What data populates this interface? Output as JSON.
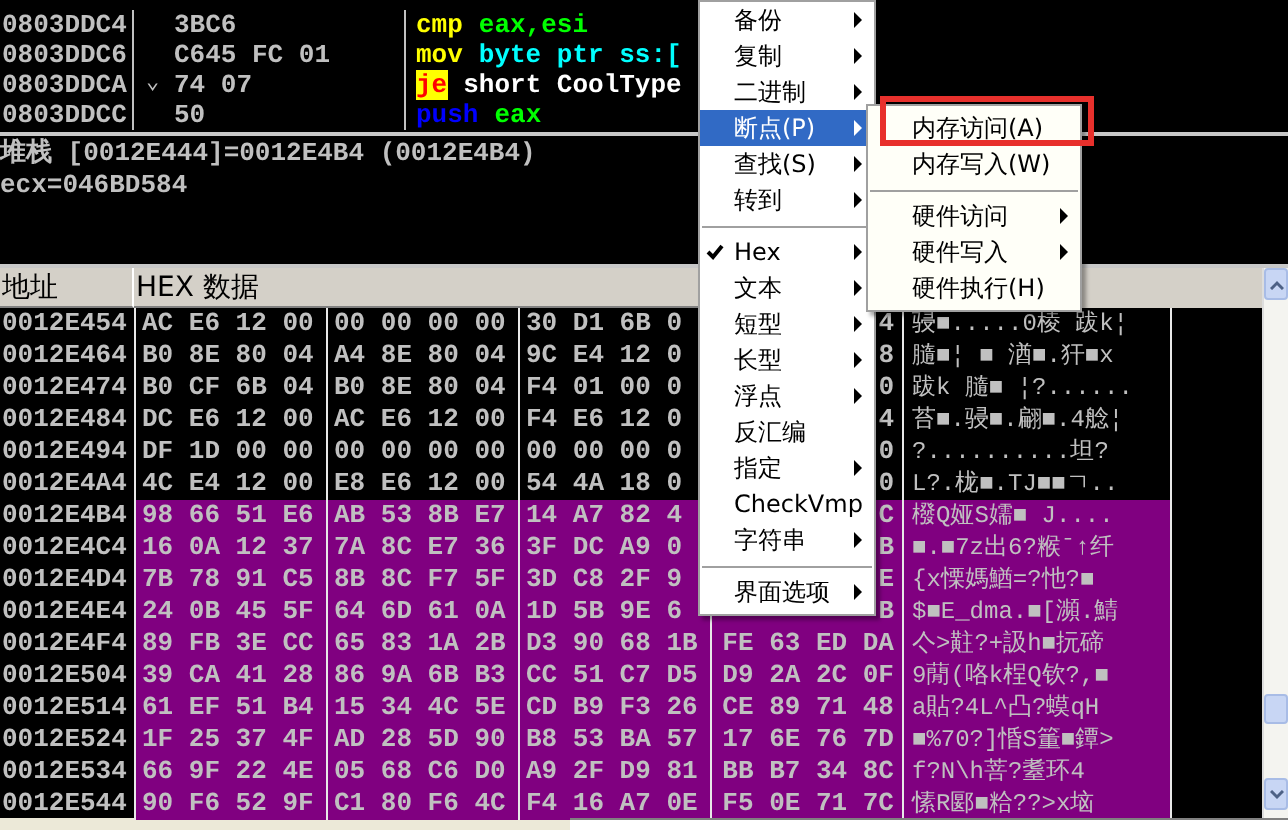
{
  "disassembly": {
    "rows": [
      {
        "address": "0803DDC4",
        "bytes": "3BC6",
        "parts": [
          {
            "text": "cmp",
            "kind": "mnemonic"
          },
          {
            "text": "eax,esi",
            "kind": "register"
          }
        ]
      },
      {
        "address": "0803DDC6",
        "bytes": "C645 FC 01",
        "parts": [
          {
            "text": "mov",
            "kind": "mnemonic"
          },
          {
            "text": "byte ptr ss:[",
            "kind": "memory"
          }
        ]
      },
      {
        "address": "0803DDCA",
        "jump_mark": "⌄",
        "bytes": "74 07",
        "parts": [
          {
            "text": "je",
            "kind": "jump"
          },
          {
            "text": "short CoolType",
            "kind": "label"
          }
        ]
      },
      {
        "address": "0803DDCC",
        "bytes": "50",
        "parts": [
          {
            "text": "push",
            "kind": "stack"
          },
          {
            "text": "eax",
            "kind": "register"
          }
        ]
      }
    ]
  },
  "info": {
    "lines": [
      "堆栈 [0012E444]=0012E4B4 (0012E4B4)",
      "ecx=046BD584"
    ]
  },
  "dump": {
    "columns": [
      "地址",
      "HEX 数据"
    ],
    "rows": [
      {
        "address": "0012E454",
        "hex": [
          "AC E6 12 00",
          "00 00 00 00",
          "30 D1 6B 0",
          "4"
        ],
        "text": "骎■.....0棱 跋k¦",
        "selected": false
      },
      {
        "address": "0012E464",
        "hex": [
          "B0 8E 80 04",
          "A4 8E 80 04",
          "9C E4 12 0",
          "8"
        ],
        "text": "膸■¦ ■ 湭■.犴■x",
        "selected": false
      },
      {
        "address": "0012E474",
        "hex": [
          "B0 CF 6B 04",
          "B0 8E 80 04",
          "F4 01 00 0",
          "0"
        ],
        "text": "跋k 膸■ ¦?......",
        "selected": false
      },
      {
        "address": "0012E484",
        "hex": [
          "DC E6 12 00",
          "AC E6 12 00",
          "F4 E6 12 0",
          "4"
        ],
        "text": "苔■.骎■.翩■.4艌¦",
        "selected": false
      },
      {
        "address": "0012E494",
        "hex": [
          "DF 1D 00 00",
          "00 00 00 00",
          "00 00 00 0",
          "0"
        ],
        "text": "?..........坦?",
        "selected": false
      },
      {
        "address": "0012E4A4",
        "hex": [
          "4C E4 12 00",
          "E8 E6 12 00",
          "54 4A 18 0",
          "0"
        ],
        "text": "L?.栊■.TJ■■ㄱ..",
        "selected": false
      },
      {
        "address": "0012E4B4",
        "hex": [
          "98 66 51 E6",
          "AB 53 8B E7",
          "14 A7 82 4",
          "C"
        ],
        "text": "橃Q娅S嬬■  J....",
        "selected": true
      },
      {
        "address": "0012E4C4",
        "hex": [
          "16 0A 12 37",
          "7A 8C E7 36",
          "3F DC A9 0",
          "B"
        ],
        "text": "■.■7z出6?糇ˉ↑纤",
        "selected": true
      },
      {
        "address": "0012E4D4",
        "hex": [
          "7B 78 91 C5",
          "8B 8C F7 5F",
          "3D C8 2F 9",
          "E"
        ],
        "text": "{x慄媽鰌=?忚?■",
        "selected": true
      },
      {
        "address": "0012E4E4",
        "hex": [
          "24 0B 45 5F",
          "64 6D 61 0A",
          "1D 5B 9E 6",
          "B"
        ],
        "text": "$■E_dma.■[瀕.鯖",
        "selected": true
      },
      {
        "address": "0012E4F4",
        "hex": [
          "89 FB 3E CC",
          "65 83 1A 2B",
          "D3 90 68 1B",
          "FE 63 ED DA"
        ],
        "text": "亽>黈?+訯h■抏碲",
        "selected": true
      },
      {
        "address": "0012E504",
        "hex": [
          "39 CA 41 28",
          "86 9A 6B B3",
          "CC 51 C7 D5",
          "D9 2A 2C 0F"
        ],
        "text": "9蕑(咯k桯Q钦?,■",
        "selected": true
      },
      {
        "address": "0012E514",
        "hex": [
          "61 EF 51 B4",
          "15 34 4C 5E",
          "CD B9 F3 26",
          "CE 89 71 48"
        ],
        "text": "a貼?4L^凸?蟆qH",
        "selected": true
      },
      {
        "address": "0012E524",
        "hex": [
          "1F 25 37 4F",
          "AD 28 5D 90",
          "B8 53 BA 57",
          "17 6E 76 7D"
        ],
        "text": "■%70?]惛S箽■鐔>",
        "selected": true
      },
      {
        "address": "0012E534",
        "hex": [
          "66 9F 22 4E",
          "05 68 C6 D0",
          "A9 2F D9 81",
          "BB B7 34 8C"
        ],
        "text": "f?N\\h菩?耋环4",
        "selected": true
      },
      {
        "address": "0012E544",
        "hex": [
          "90 F6 52 9F",
          "C1 80 F6 4C",
          "F4 16 A7 0E",
          "F5 0E 71 7C"
        ],
        "text": "愫R郾■粭??>x垴",
        "selected": true
      }
    ]
  },
  "context_menu": {
    "items": [
      {
        "kind": "item",
        "label": "备份",
        "has_submenu": true,
        "selected": false,
        "checked": false
      },
      {
        "kind": "item",
        "label": "复制",
        "has_submenu": true,
        "selected": false,
        "checked": false
      },
      {
        "kind": "item",
        "label": "二进制",
        "has_submenu": true,
        "selected": false,
        "checked": false
      },
      {
        "kind": "item",
        "label": "断点(P)",
        "has_submenu": true,
        "selected": true,
        "checked": false
      },
      {
        "kind": "item",
        "label": "查找(S)",
        "has_submenu": true,
        "selected": false,
        "checked": false
      },
      {
        "kind": "item",
        "label": "转到",
        "has_submenu": true,
        "selected": false,
        "checked": false
      },
      {
        "kind": "separator"
      },
      {
        "kind": "item",
        "label": "Hex",
        "has_submenu": true,
        "selected": false,
        "checked": true
      },
      {
        "kind": "item",
        "label": "文本",
        "has_submenu": true,
        "selected": false,
        "checked": false
      },
      {
        "kind": "item",
        "label": "短型",
        "has_submenu": true,
        "selected": false,
        "checked": false
      },
      {
        "kind": "item",
        "label": "长型",
        "has_submenu": true,
        "selected": false,
        "checked": false
      },
      {
        "kind": "item",
        "label": "浮点",
        "has_submenu": true,
        "selected": false,
        "checked": false
      },
      {
        "kind": "item",
        "label": "反汇编",
        "has_submenu": false,
        "selected": false,
        "checked": false
      },
      {
        "kind": "item",
        "label": "指定",
        "has_submenu": true,
        "selected": false,
        "checked": false
      },
      {
        "kind": "item",
        "label": "CheckVmp",
        "has_submenu": false,
        "selected": false,
        "checked": false
      },
      {
        "kind": "item",
        "label": "字符串",
        "has_submenu": true,
        "selected": false,
        "checked": false
      },
      {
        "kind": "separator"
      },
      {
        "kind": "item",
        "label": "界面选项",
        "has_submenu": true,
        "selected": false,
        "checked": false
      }
    ]
  },
  "submenu": {
    "items": [
      {
        "kind": "item",
        "label": "内存访问(A)",
        "has_submenu": false,
        "annotated": true
      },
      {
        "kind": "item",
        "label": "内存写入(W)",
        "has_submenu": false,
        "annotated": false
      },
      {
        "kind": "separator"
      },
      {
        "kind": "item",
        "label": "硬件访问",
        "has_submenu": true,
        "annotated": false
      },
      {
        "kind": "item",
        "label": "硬件写入",
        "has_submenu": true,
        "annotated": false
      },
      {
        "kind": "item",
        "label": "硬件执行(H)",
        "has_submenu": false,
        "annotated": false
      }
    ]
  }
}
